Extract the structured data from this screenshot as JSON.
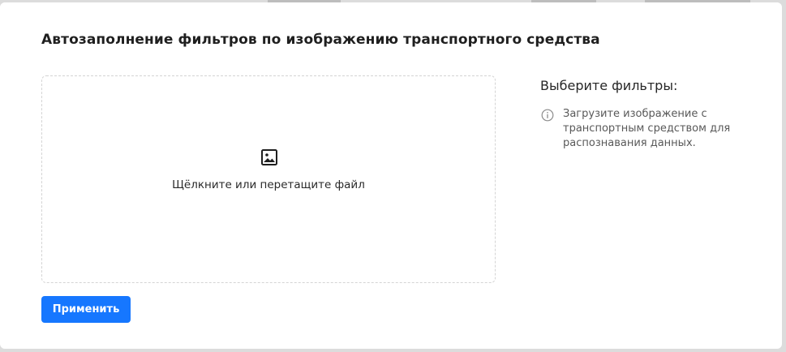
{
  "modal": {
    "title": "Автозаполнение фильтров по изображению транспортного средства"
  },
  "upload": {
    "icon": "image-icon",
    "hint": "Щёлкните или перетащите файл"
  },
  "filters": {
    "title": "Выберите фильтры:",
    "info_icon": "info-icon",
    "info_text": "Загрузите изображение с транспортным средством для распознавания данных."
  },
  "actions": {
    "apply_label": "Применить"
  },
  "colors": {
    "accent": "#1677ff",
    "border_dashed": "#d4d4d4",
    "muted_text": "#595959"
  }
}
